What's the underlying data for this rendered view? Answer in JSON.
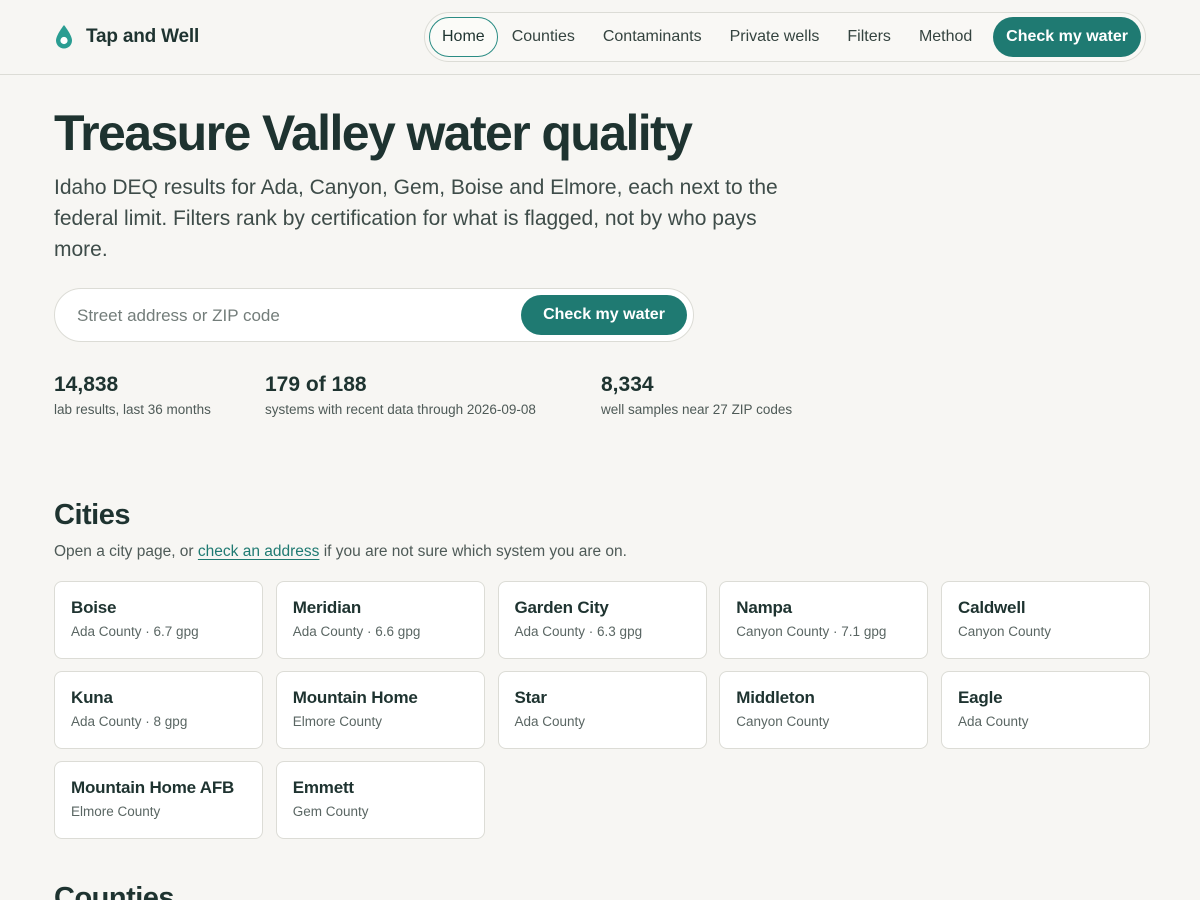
{
  "brand": {
    "name": "Tap and Well",
    "icon": "water-drop-icon",
    "accent": "#1f7a72"
  },
  "nav": {
    "items": [
      "Home",
      "Counties",
      "Contaminants",
      "Private wells",
      "Filters",
      "Method"
    ],
    "active": "Home",
    "cta_label": "Check my water"
  },
  "hero": {
    "title": "Treasure Valley water quality",
    "subtitle": "Idaho DEQ results for Ada, Canyon, Gem, Boise and Elmore, each next to the federal limit. Filters rank by certification for what is flagged, not by who pays more."
  },
  "search": {
    "placeholder": "Street address or ZIP code",
    "value": "",
    "button_label": "Check my water"
  },
  "stats": [
    {
      "value": "14,838",
      "label": "lab results, last 36 months"
    },
    {
      "value": "179 of 188",
      "label": "systems with recent data through 2026-09-08"
    },
    {
      "value": "8,334",
      "label": "well samples near 27 ZIP codes"
    }
  ],
  "cities": {
    "title": "Cities",
    "intro_before": "Open a city page, or",
    "intro_link": "check an address",
    "intro_after": "if you are not sure which system you are on.",
    "items": [
      {
        "name": "Boise",
        "meta": "Ada County · 6.7 gpg"
      },
      {
        "name": "Meridian",
        "meta": "Ada County · 6.6 gpg"
      },
      {
        "name": "Garden City",
        "meta": "Ada County · 6.3 gpg"
      },
      {
        "name": "Nampa",
        "meta": "Canyon County · 7.1 gpg"
      },
      {
        "name": "Caldwell",
        "meta": "Canyon County"
      },
      {
        "name": "Kuna",
        "meta": "Ada County · 8 gpg"
      },
      {
        "name": "Mountain Home",
        "meta": "Elmore County"
      },
      {
        "name": "Star",
        "meta": "Ada County"
      },
      {
        "name": "Middleton",
        "meta": "Canyon County"
      },
      {
        "name": "Eagle",
        "meta": "Ada County"
      },
      {
        "name": "Mountain Home AFB",
        "meta": "Elmore County"
      },
      {
        "name": "Emmett",
        "meta": "Gem County"
      }
    ]
  },
  "counties": {
    "title": "Counties"
  }
}
